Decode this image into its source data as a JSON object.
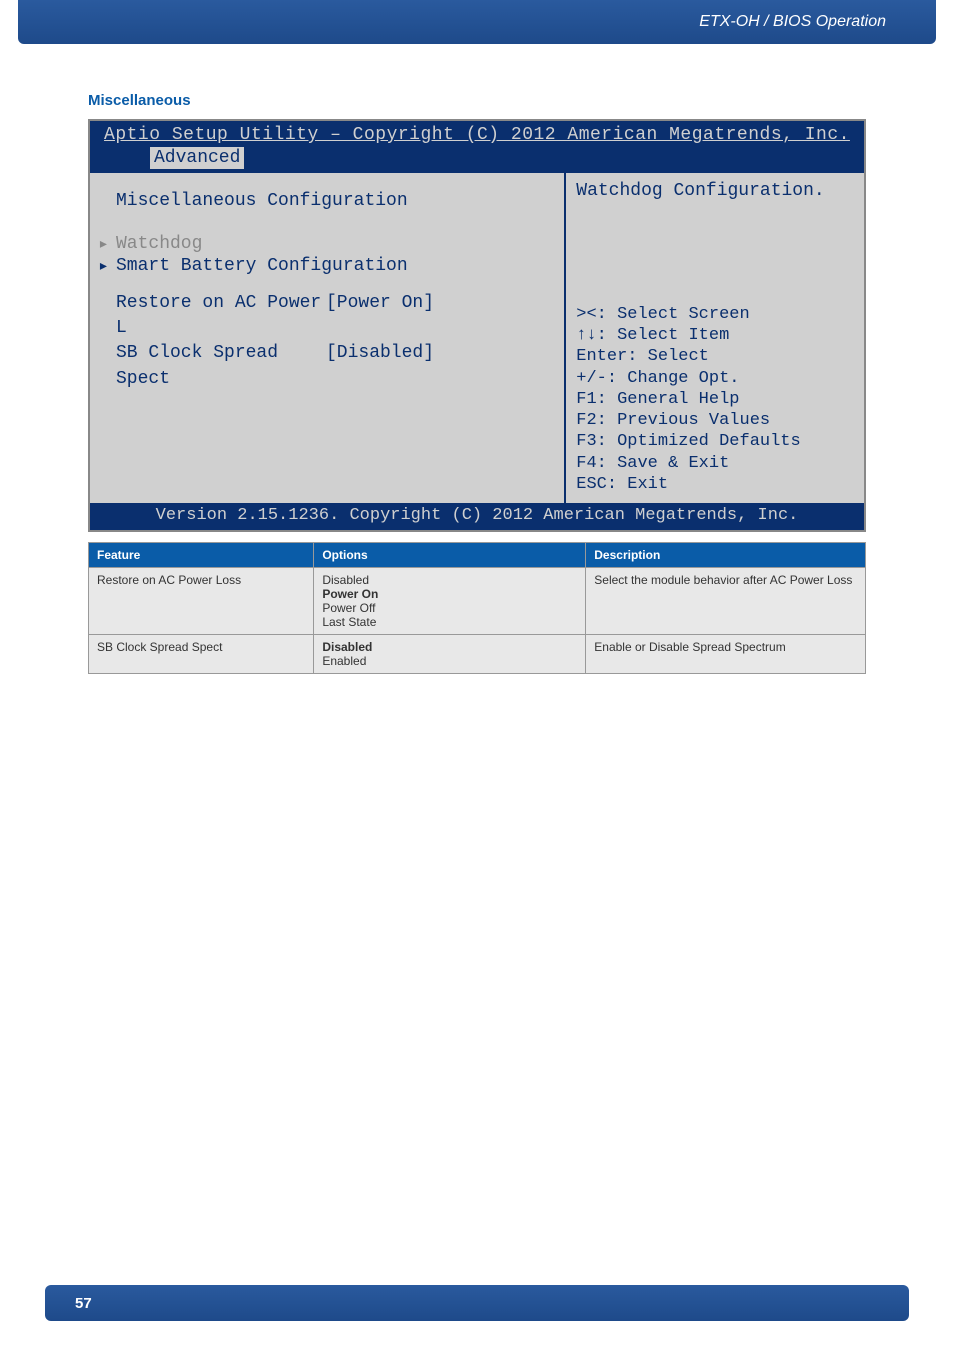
{
  "header": {
    "breadcrumb": "ETX-OH / BIOS Operation"
  },
  "section": {
    "title": "Miscellaneous"
  },
  "bios": {
    "title": "Aptio Setup Utility – Copyright (C) 2012 American Megatrends, Inc.",
    "tab": "Advanced",
    "left": {
      "heading": "Miscellaneous Configuration",
      "submenu1": "Watchdog",
      "submenu2": "Smart Battery Configuration",
      "opt1_label": "Restore on AC Power L",
      "opt1_value": "[Power On]",
      "opt2_label": "SB Clock Spread Spect",
      "opt2_value": "[Disabled]"
    },
    "right": {
      "help": "Watchdog Configuration.",
      "keys": {
        "k1": "><: Select Screen",
        "k2": "↑↓: Select Item",
        "k3": "Enter: Select",
        "k4": "+/-: Change Opt.",
        "k5": "F1: General Help",
        "k6": "F2: Previous Values",
        "k7": "F3: Optimized Defaults",
        "k8": "F4: Save & Exit",
        "k9": "ESC: Exit"
      }
    },
    "footer": "Version 2.15.1236. Copyright (C) 2012 American Megatrends, Inc."
  },
  "table": {
    "headers": {
      "feature": "Feature",
      "options": "Options",
      "description": "Description"
    },
    "rows": [
      {
        "feature": "Restore on AC Power Loss",
        "options": [
          "Disabled",
          "Power On",
          "Power Off",
          "Last State"
        ],
        "default_index": 1,
        "description": "Select the module behavior after AC Power Loss"
      },
      {
        "feature": "SB Clock Spread Spect",
        "options": [
          "Disabled",
          "Enabled"
        ],
        "default_index": 0,
        "description": "Enable or Disable Spread Spectrum"
      }
    ]
  },
  "page": {
    "number": "57"
  }
}
